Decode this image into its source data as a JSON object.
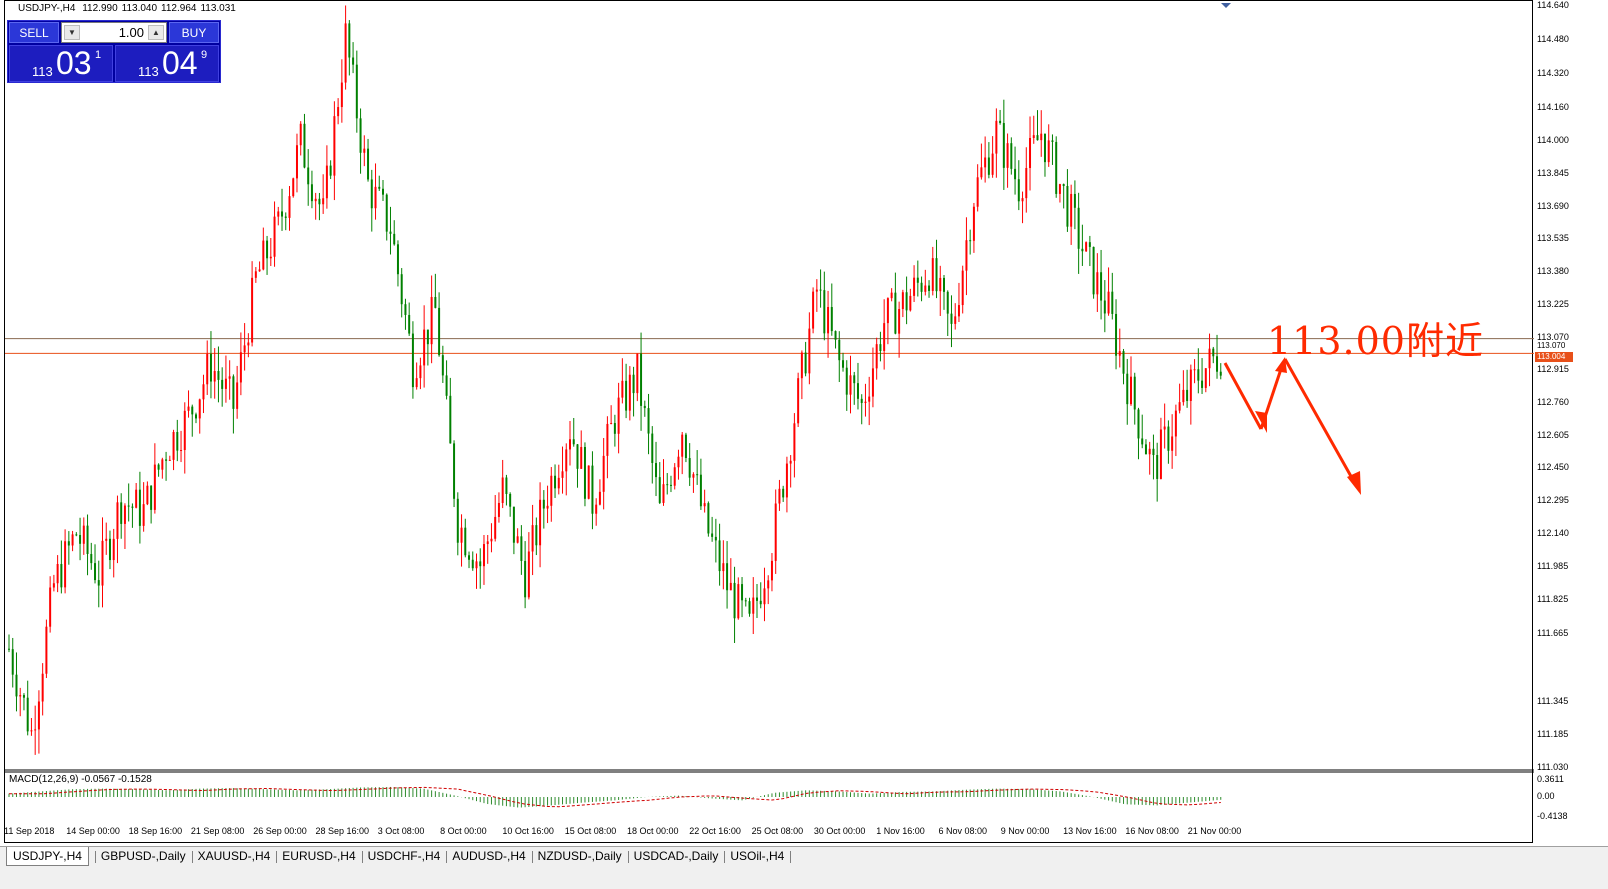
{
  "window": {
    "symbol_tf": "USDJPY-,H4",
    "ohlc": [
      "112.990",
      "113.040",
      "112.964",
      "113.031"
    ]
  },
  "trade_panel": {
    "sell_label": "SELL",
    "buy_label": "BUY",
    "lot": "1.00",
    "sell_price_small": "113",
    "sell_price_big": "03",
    "sell_price_sup": "1",
    "buy_price_small": "113",
    "buy_price_big": "04",
    "buy_price_sup": "9"
  },
  "annotation": {
    "text": "113.00附近",
    "color": "#ff2a00"
  },
  "price_tags": {
    "ask": "113.070",
    "bid": "113.004",
    "bid_color": "#e8501a"
  },
  "macd": {
    "label": "MACD(12,26,9) -0.0567 -0.1528",
    "axis": [
      "0.3611",
      "0.00",
      "-0.4138"
    ]
  },
  "tabs": [
    {
      "label": "USDJPY-,H4",
      "active": true
    },
    {
      "label": "GBPUSD-,Daily",
      "active": false
    },
    {
      "label": "XAUUSD-,H4",
      "active": false
    },
    {
      "label": "EURUSD-,H4",
      "active": false
    },
    {
      "label": "USDCHF-,H4",
      "active": false
    },
    {
      "label": "AUDUSD-,H4",
      "active": false
    },
    {
      "label": "NZDUSD-,Daily",
      "active": false
    },
    {
      "label": "USDCAD-,Daily",
      "active": false
    },
    {
      "label": "USOil-,H4",
      "active": false
    }
  ],
  "chart_data": {
    "type": "candlestick",
    "y_ticks": [
      "114.640",
      "114.480",
      "114.320",
      "114.160",
      "114.000",
      "113.845",
      "113.690",
      "113.535",
      "113.380",
      "113.225",
      "113.070",
      "112.915",
      "112.760",
      "112.605",
      "112.450",
      "112.295",
      "112.140",
      "111.985",
      "111.825",
      "111.665",
      "111.345",
      "111.185",
      "111.030"
    ],
    "ylim": [
      111.03,
      114.67
    ],
    "x_ticks": [
      "11 Sep 2018",
      "14 Sep 00:00",
      "18 Sep 16:00",
      "21 Sep 08:00",
      "26 Sep 00:00",
      "28 Sep 16:00",
      "3 Oct 08:00",
      "8 Oct 00:00",
      "10 Oct 16:00",
      "15 Oct 08:00",
      "18 Oct 00:00",
      "22 Oct 16:00",
      "25 Oct 08:00",
      "30 Oct 00:00",
      "1 Nov 16:00",
      "6 Nov 08:00",
      "9 Nov 00:00",
      "13 Nov 16:00",
      "16 Nov 08:00",
      "21 Nov 00:00"
    ],
    "up_color": "#ff0000",
    "down_color": "#008000",
    "h_lines": [
      113.07,
      113.0
    ],
    "price_path": [
      [
        0,
        111.6
      ],
      [
        6,
        111.2
      ],
      [
        12,
        111.9
      ],
      [
        18,
        112.15
      ],
      [
        24,
        111.95
      ],
      [
        30,
        112.3
      ],
      [
        36,
        112.25
      ],
      [
        42,
        112.55
      ],
      [
        48,
        112.7
      ],
      [
        54,
        112.95
      ],
      [
        60,
        112.75
      ],
      [
        66,
        113.35
      ],
      [
        72,
        113.6
      ],
      [
        78,
        114.0
      ],
      [
        84,
        113.65
      ],
      [
        90,
        114.5
      ],
      [
        96,
        113.8
      ],
      [
        102,
        113.6
      ],
      [
        108,
        112.95
      ],
      [
        114,
        113.2
      ],
      [
        120,
        112.2
      ],
      [
        126,
        112.0
      ],
      [
        132,
        112.35
      ],
      [
        138,
        111.95
      ],
      [
        144,
        112.35
      ],
      [
        150,
        112.65
      ],
      [
        156,
        112.3
      ],
      [
        162,
        112.7
      ],
      [
        168,
        112.9
      ],
      [
        174,
        112.25
      ],
      [
        180,
        112.65
      ],
      [
        186,
        112.2
      ],
      [
        192,
        111.9
      ],
      [
        198,
        111.7
      ],
      [
        204,
        112.1
      ],
      [
        210,
        112.7
      ],
      [
        216,
        113.3
      ],
      [
        222,
        112.95
      ],
      [
        228,
        112.75
      ],
      [
        234,
        113.15
      ],
      [
        240,
        113.25
      ],
      [
        246,
        113.4
      ],
      [
        252,
        113.1
      ],
      [
        258,
        113.75
      ],
      [
        264,
        114.05
      ],
      [
        270,
        113.8
      ],
      [
        276,
        114.05
      ],
      [
        282,
        113.75
      ],
      [
        288,
        113.45
      ],
      [
        294,
        113.2
      ],
      [
        300,
        112.8
      ],
      [
        306,
        112.45
      ],
      [
        312,
        112.7
      ],
      [
        318,
        112.9
      ],
      [
        324,
        113.0
      ]
    ],
    "macd_series": {
      "name": "MACD(12,26,9)",
      "values": [
        0.12,
        0.2,
        0.28,
        0.3,
        0.28,
        0.24,
        0.3,
        0.32,
        0.28,
        0.24,
        0.28,
        0.34,
        0.36,
        0.3,
        0.05,
        -0.25,
        -0.38,
        -0.3,
        -0.2,
        -0.12,
        0.0,
        0.05,
        -0.05,
        -0.12,
        0.15,
        0.24,
        0.2,
        0.12,
        0.18,
        0.2,
        0.26,
        0.3,
        0.28,
        0.2,
        0.0,
        -0.26,
        -0.3,
        -0.2,
        -0.1
      ]
    }
  }
}
